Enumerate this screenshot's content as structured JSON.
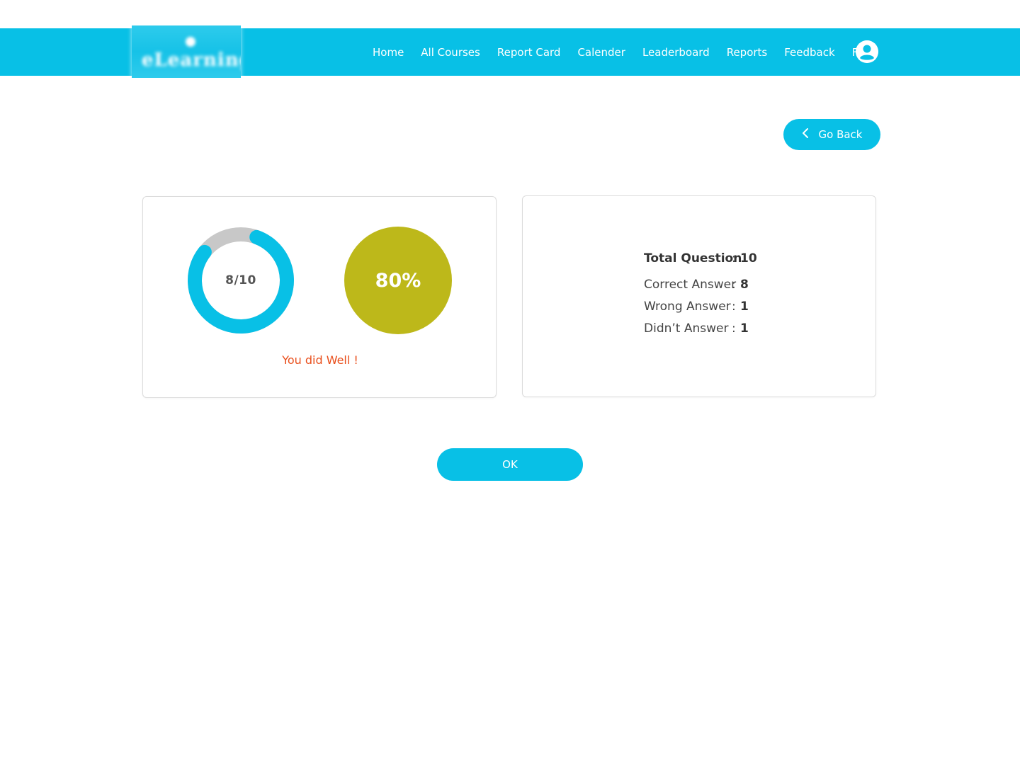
{
  "brand": {
    "logo_text": "eLearning"
  },
  "nav": {
    "items": [
      {
        "label": "Home"
      },
      {
        "label": "All Courses"
      },
      {
        "label": "Report Card"
      },
      {
        "label": "Calender"
      },
      {
        "label": "Leaderboard"
      },
      {
        "label": "Reports"
      },
      {
        "label": "Feedback"
      },
      {
        "label": "FAQ"
      }
    ],
    "profile_icon": "user-circle-icon"
  },
  "actions": {
    "go_back_label": "Go Back",
    "go_back_icon": "chevron-left-icon",
    "ok_label": "OK"
  },
  "result": {
    "score_label": "8/10",
    "score_fraction": 0.8,
    "percent_label": "80%",
    "message": "You did Well !"
  },
  "summary": {
    "rows": [
      {
        "label": "Total Question",
        "value": "10"
      },
      {
        "label": "Correct Answer",
        "value": "8"
      },
      {
        "label": "Wrong Answer",
        "value": "1"
      },
      {
        "label": "Didn’t Answer",
        "value": "1"
      }
    ],
    "separator": ":"
  },
  "colors": {
    "accent": "#08c0e6",
    "score_circle": "#bdb81a",
    "ring_remaining": "#c8c8c8",
    "message": "#e94e1b"
  }
}
